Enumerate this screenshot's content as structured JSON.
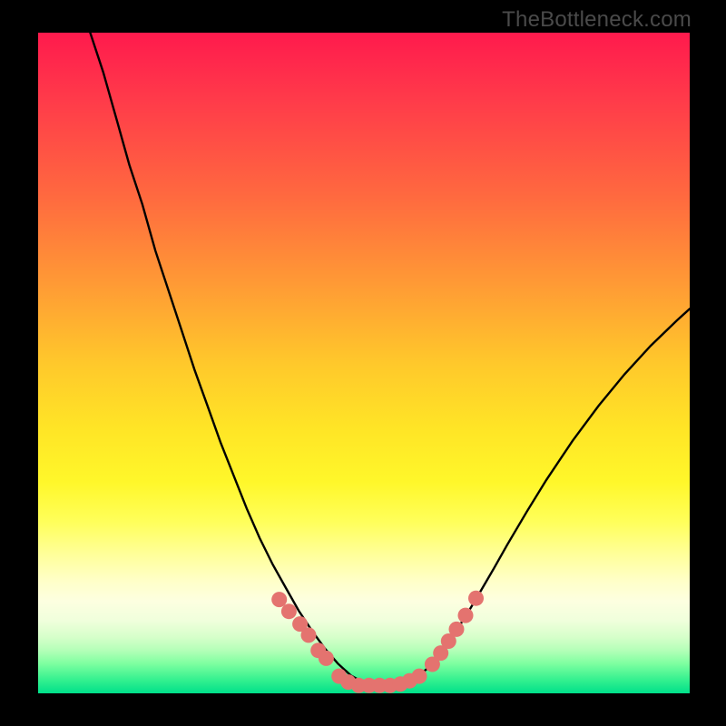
{
  "watermark": "TheBottleneck.com",
  "chart_data": {
    "type": "line",
    "title": "",
    "xlabel": "",
    "ylabel": "",
    "xlim": [
      0,
      100
    ],
    "ylim": [
      0,
      100
    ],
    "grid": false,
    "legend": false,
    "background": "rainbow-gradient-red-to-green",
    "series": [
      {
        "name": "bottleneck-curve",
        "type": "line",
        "color": "#000000",
        "x": [
          8,
          10,
          12,
          14,
          16,
          18,
          20,
          22,
          24,
          26,
          28,
          30,
          32,
          34,
          36,
          38,
          40,
          42,
          44,
          46,
          48,
          50,
          52,
          54,
          56,
          58,
          60,
          62,
          64,
          66,
          68,
          70,
          72,
          75,
          78,
          82,
          86,
          90,
          94,
          98,
          100
        ],
        "y": [
          100,
          94,
          87,
          80,
          74,
          67,
          61,
          55,
          49,
          43.5,
          38,
          33,
          28,
          23.5,
          19.5,
          16,
          12.5,
          9.5,
          6.8,
          4.5,
          2.7,
          1.6,
          1.2,
          1.2,
          1.5,
          2.3,
          4,
          6.4,
          9.2,
          12.3,
          15.6,
          19,
          22.5,
          27.5,
          32.3,
          38.2,
          43.5,
          48.3,
          52.6,
          56.4,
          58.2
        ]
      },
      {
        "name": "data-points",
        "type": "scatter",
        "color": "#e4736f",
        "x": [
          37,
          38.5,
          40.2,
          41.5,
          43,
          44.2,
          46.2,
          47.6,
          49.2,
          50.8,
          52.4,
          54,
          55.6,
          57,
          58.5,
          60.5,
          61.8,
          63,
          64.2,
          65.6,
          67.2
        ],
        "y": [
          14.2,
          12.4,
          10.5,
          8.8,
          6.5,
          5.3,
          2.6,
          1.7,
          1.2,
          1.2,
          1.2,
          1.2,
          1.4,
          1.9,
          2.6,
          4.4,
          6.1,
          7.9,
          9.7,
          11.8,
          14.4
        ]
      }
    ]
  }
}
